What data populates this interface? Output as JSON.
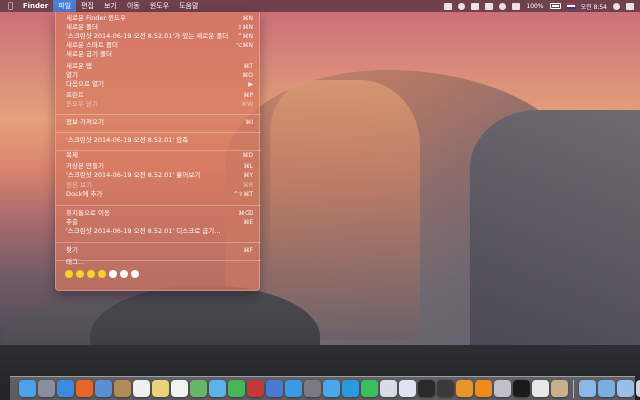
{
  "menubar": {
    "apple": "",
    "app_name": "Finder",
    "menus": [
      "파일",
      "편집",
      "보기",
      "이동",
      "윈도우",
      "도움말"
    ],
    "status": {
      "battery": "100%",
      "time": "오전 8:54"
    }
  },
  "file_menu": {
    "items": [
      {
        "label": "새로운 Finder 윈도우",
        "shortcut": "⌘N"
      },
      {
        "label": "새로운 폴더",
        "shortcut": "⇧⌘N"
      },
      {
        "label": "'스크린샷 2014-06-19 오전 8.52.01'가 있는 새로운 폴더",
        "shortcut": "^⌘N"
      },
      {
        "label": "새로운 스마트 폴더",
        "shortcut": "⌥⌘N"
      },
      {
        "label": "새로운 굽기 폴더",
        "shortcut": ""
      },
      {
        "label": "새로운 탭",
        "shortcut": "⌘T"
      },
      {
        "label": "열기",
        "shortcut": "⌘O"
      },
      {
        "label": "다음으로 열기",
        "shortcut": "▶"
      },
      {
        "label": "프린트",
        "shortcut": "⌘P"
      },
      {
        "label": "윈도우 닫기",
        "shortcut": "⌘W"
      },
      {
        "label": "정보 가져오기",
        "shortcut": "⌘I"
      },
      {
        "label": "'스크린샷 2014-06-19 오전 8.52.01' 압축",
        "shortcut": ""
      },
      {
        "label": "복제",
        "shortcut": "⌘D"
      },
      {
        "label": "가상본 만들기",
        "shortcut": "⌘L"
      },
      {
        "label": "'스크린샷 2014-06-19 오전 8.52.01' 훑어보기",
        "shortcut": "⌘Y"
      },
      {
        "label": "원본 보기",
        "shortcut": "⌘R"
      },
      {
        "label": "Dock에 추가",
        "shortcut": "^⇧⌘T"
      },
      {
        "label": "휴지통으로 이동",
        "shortcut": "⌘⌫"
      },
      {
        "label": "추출",
        "shortcut": "⌘E"
      },
      {
        "label": "'스크린샷 2014-06-19 오전 8.52.01' 디스크로 굽기...",
        "shortcut": ""
      },
      {
        "label": "찾기",
        "shortcut": "⌘F"
      },
      {
        "label": "태그...",
        "shortcut": ""
      }
    ],
    "tag_colors": [
      "#f6d32a",
      "#f6d32a",
      "#f6d32a",
      "#f6d32a",
      "#ffffff",
      "#ffffff",
      "#ffffff"
    ]
  },
  "dock": {
    "apps": [
      {
        "name": "finder-icon",
        "color": "#4aa3e8"
      },
      {
        "name": "launchpad-icon",
        "color": "#8a8fa0"
      },
      {
        "name": "safari-icon",
        "color": "#3d8be0"
      },
      {
        "name": "firefox-icon",
        "color": "#e8662a"
      },
      {
        "name": "mail-icon",
        "color": "#5a8fd0"
      },
      {
        "name": "contacts-icon",
        "color": "#b38a5a"
      },
      {
        "name": "calendar-icon",
        "color": "#f0f0f0"
      },
      {
        "name": "notes-icon",
        "color": "#e8d27a"
      },
      {
        "name": "reminders-icon",
        "color": "#f2f2f2"
      },
      {
        "name": "maps-icon",
        "color": "#6ab46a"
      },
      {
        "name": "messages-icon",
        "color": "#5ab4e8"
      },
      {
        "name": "facetime-icon",
        "color": "#4ab45a"
      },
      {
        "name": "photo-booth-icon",
        "color": "#c03a3a"
      },
      {
        "name": "itunes-icon",
        "color": "#4a7ad0"
      },
      {
        "name": "app-store-icon",
        "color": "#3a9ae8"
      },
      {
        "name": "system-preferences-icon",
        "color": "#7a7a82"
      },
      {
        "name": "twitter-icon",
        "color": "#4aa8e8"
      },
      {
        "name": "skype-icon",
        "color": "#2a9ae0"
      },
      {
        "name": "line-icon",
        "color": "#3ac05a"
      },
      {
        "name": "preview-icon",
        "color": "#d8dce8"
      },
      {
        "name": "mail-app-icon",
        "color": "#e0e4f0"
      },
      {
        "name": "terminal-app-icon",
        "color": "#2a2a2a"
      },
      {
        "name": "dvd-player-icon",
        "color": "#3a3a3a"
      },
      {
        "name": "ibooks-icon",
        "color": "#e8952a"
      },
      {
        "name": "vlc-icon",
        "color": "#f08a1a"
      },
      {
        "name": "scrivener-icon",
        "color": "#c0c0c8"
      },
      {
        "name": "terminal-icon",
        "color": "#1a1a1a"
      },
      {
        "name": "textedit-icon",
        "color": "#e8e8e8"
      },
      {
        "name": "photos-icon",
        "color": "#c8b08a"
      }
    ],
    "stacks": [
      {
        "name": "documents-folder-icon",
        "color": "#8ab8e8"
      },
      {
        "name": "downloads-folder-icon",
        "color": "#7aaee0"
      },
      {
        "name": "applications-folder-icon",
        "color": "#9ac0ea"
      },
      {
        "name": "trash-icon",
        "color": "#d0d4da"
      }
    ]
  }
}
